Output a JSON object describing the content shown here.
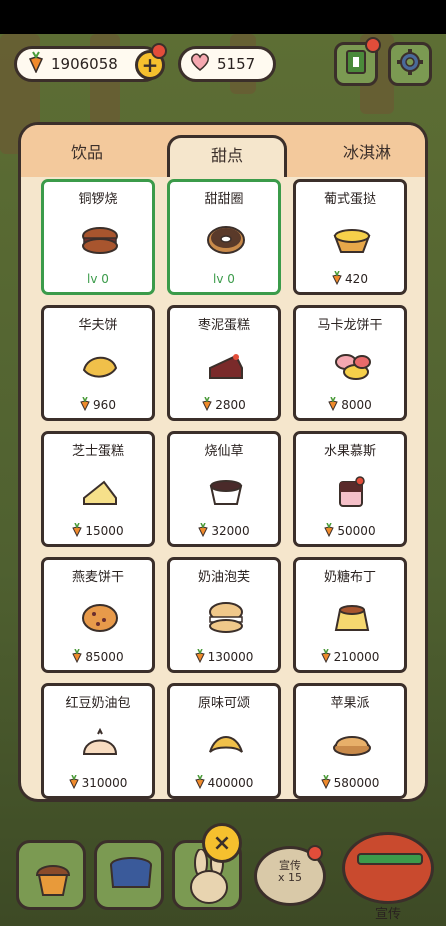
{
  "header": {
    "carrots": "1906058",
    "hearts": "5157",
    "plus_label": "+"
  },
  "tabs": [
    {
      "label": "饮品",
      "active": false
    },
    {
      "label": "甜点",
      "active": true
    },
    {
      "label": "冰淇淋",
      "active": false
    }
  ],
  "items": [
    {
      "name": "铜锣烧",
      "status": "lv 0",
      "owned": true,
      "icon": "dorayaki-icon"
    },
    {
      "name": "甜甜圈",
      "status": "lv 0",
      "owned": true,
      "icon": "donut-icon"
    },
    {
      "name": "葡式蛋挞",
      "price": "420",
      "owned": false,
      "icon": "egg-tart-icon"
    },
    {
      "name": "华夫饼",
      "price": "960",
      "owned": false,
      "icon": "waffle-icon"
    },
    {
      "name": "枣泥蛋糕",
      "price": "2800",
      "owned": false,
      "icon": "date-cake-icon"
    },
    {
      "name": "马卡龙饼干",
      "price": "8000",
      "owned": false,
      "icon": "macaron-icon"
    },
    {
      "name": "芝士蛋糕",
      "price": "15000",
      "owned": false,
      "icon": "cheesecake-icon"
    },
    {
      "name": "烧仙草",
      "price": "32000",
      "owned": false,
      "icon": "grass-jelly-icon"
    },
    {
      "name": "水果慕斯",
      "price": "50000",
      "owned": false,
      "icon": "fruit-mousse-icon"
    },
    {
      "name": "燕麦饼干",
      "price": "85000",
      "owned": false,
      "icon": "oat-cookie-icon"
    },
    {
      "name": "奶油泡芙",
      "price": "130000",
      "owned": false,
      "icon": "cream-puff-icon"
    },
    {
      "name": "奶糖布丁",
      "price": "210000",
      "owned": false,
      "icon": "pudding-icon"
    },
    {
      "name": "红豆奶油包",
      "price": "310000",
      "owned": false,
      "icon": "red-bean-bun-icon"
    },
    {
      "name": "原味可颂",
      "price": "400000",
      "owned": false,
      "icon": "croissant-icon"
    },
    {
      "name": "苹果派",
      "price": "580000",
      "owned": false,
      "icon": "apple-pie-icon"
    }
  ],
  "bottom": {
    "promo_small": "宣传",
    "promo_count": "x 15",
    "promo_big": "宣传",
    "close_label": "×"
  },
  "colors": {
    "owned_border": "#3b9b4a",
    "tab_bg": "#f3c99c",
    "panel_bg": "#f5e6cc",
    "coin_yellow": "#f6c02e"
  }
}
